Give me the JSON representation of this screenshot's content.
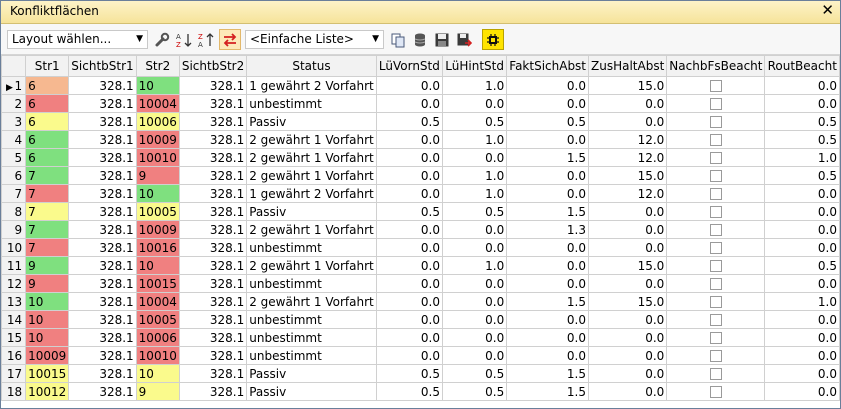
{
  "window": {
    "title": "Konfliktflächen"
  },
  "toolbar": {
    "layout_select": "Layout wählen...",
    "list_select": "<Einfache Liste>"
  },
  "colors": {
    "green": "#7fe07f",
    "red": "#f08080",
    "yellow": "#fafa8c",
    "orange": "#f6b890"
  },
  "columns": [
    "Str1",
    "SichtbStr1",
    "Str2",
    "SichtbStr2",
    "Status",
    "LüVornStd",
    "LüHintStd",
    "FaktSichAbst",
    "ZusHaltAbst",
    "NachbFsBeacht",
    "RoutBeacht"
  ],
  "rows": [
    {
      "n": "1",
      "str1": "6",
      "str1_color": "orange",
      "sichtb1": "328.1",
      "str2": "10",
      "str2_color": "green",
      "sichtb2": "328.1",
      "status": "1 gewährt 2 Vorfahrt",
      "luvorn": "0.0",
      "luhint": "1.0",
      "fakt": "0.0",
      "zus": "15.0",
      "rout": "0.0"
    },
    {
      "n": "2",
      "str1": "6",
      "str1_color": "red",
      "sichtb1": "328.1",
      "str2": "10004",
      "str2_color": "red",
      "sichtb2": "328.1",
      "status": "unbestimmt",
      "luvorn": "0.0",
      "luhint": "0.0",
      "fakt": "0.0",
      "zus": "0.0",
      "rout": "0.0"
    },
    {
      "n": "3",
      "str1": "6",
      "str1_color": "yellow",
      "sichtb1": "328.1",
      "str2": "10006",
      "str2_color": "yellow",
      "sichtb2": "328.1",
      "status": "Passiv",
      "luvorn": "0.5",
      "luhint": "0.5",
      "fakt": "0.5",
      "zus": "0.0",
      "rout": "0.5"
    },
    {
      "n": "4",
      "str1": "6",
      "str1_color": "green",
      "sichtb1": "328.1",
      "str2": "10009",
      "str2_color": "red",
      "sichtb2": "328.1",
      "status": "2 gewährt 1 Vorfahrt",
      "luvorn": "0.0",
      "luhint": "1.0",
      "fakt": "0.0",
      "zus": "12.0",
      "rout": "0.5"
    },
    {
      "n": "5",
      "str1": "6",
      "str1_color": "green",
      "sichtb1": "328.1",
      "str2": "10010",
      "str2_color": "red",
      "sichtb2": "328.1",
      "status": "2 gewährt 1 Vorfahrt",
      "luvorn": "0.0",
      "luhint": "0.0",
      "fakt": "1.5",
      "zus": "12.0",
      "rout": "1.0"
    },
    {
      "n": "6",
      "str1": "7",
      "str1_color": "green",
      "sichtb1": "328.1",
      "str2": "9",
      "str2_color": "red",
      "sichtb2": "328.1",
      "status": "2 gewährt 1 Vorfahrt",
      "luvorn": "0.0",
      "luhint": "1.0",
      "fakt": "0.0",
      "zus": "15.0",
      "rout": "0.5"
    },
    {
      "n": "7",
      "str1": "7",
      "str1_color": "red",
      "sichtb1": "328.1",
      "str2": "10",
      "str2_color": "green",
      "sichtb2": "328.1",
      "status": "1 gewährt 2 Vorfahrt",
      "luvorn": "0.0",
      "luhint": "1.0",
      "fakt": "0.0",
      "zus": "12.0",
      "rout": "0.0"
    },
    {
      "n": "8",
      "str1": "7",
      "str1_color": "yellow",
      "sichtb1": "328.1",
      "str2": "10005",
      "str2_color": "yellow",
      "sichtb2": "328.1",
      "status": "Passiv",
      "luvorn": "0.5",
      "luhint": "0.5",
      "fakt": "1.5",
      "zus": "0.0",
      "rout": "0.0"
    },
    {
      "n": "9",
      "str1": "7",
      "str1_color": "green",
      "sichtb1": "328.1",
      "str2": "10009",
      "str2_color": "red",
      "sichtb2": "328.1",
      "status": "2 gewährt 1 Vorfahrt",
      "luvorn": "0.0",
      "luhint": "0.0",
      "fakt": "1.3",
      "zus": "0.0",
      "rout": "0.0"
    },
    {
      "n": "10",
      "str1": "7",
      "str1_color": "red",
      "sichtb1": "328.1",
      "str2": "10016",
      "str2_color": "red",
      "sichtb2": "328.1",
      "status": "unbestimmt",
      "luvorn": "0.0",
      "luhint": "0.0",
      "fakt": "0.0",
      "zus": "0.0",
      "rout": "0.0"
    },
    {
      "n": "11",
      "str1": "9",
      "str1_color": "green",
      "sichtb1": "328.1",
      "str2": "10",
      "str2_color": "red",
      "sichtb2": "328.1",
      "status": "2 gewährt 1 Vorfahrt",
      "luvorn": "0.0",
      "luhint": "1.0",
      "fakt": "0.0",
      "zus": "15.0",
      "rout": "0.5"
    },
    {
      "n": "12",
      "str1": "9",
      "str1_color": "red",
      "sichtb1": "328.1",
      "str2": "10015",
      "str2_color": "red",
      "sichtb2": "328.1",
      "status": "unbestimmt",
      "luvorn": "0.0",
      "luhint": "0.0",
      "fakt": "0.0",
      "zus": "0.0",
      "rout": "0.0"
    },
    {
      "n": "13",
      "str1": "10",
      "str1_color": "green",
      "sichtb1": "328.1",
      "str2": "10004",
      "str2_color": "red",
      "sichtb2": "328.1",
      "status": "2 gewährt 1 Vorfahrt",
      "luvorn": "0.0",
      "luhint": "0.0",
      "fakt": "1.5",
      "zus": "15.0",
      "rout": "1.0"
    },
    {
      "n": "14",
      "str1": "10",
      "str1_color": "red",
      "sichtb1": "328.1",
      "str2": "10005",
      "str2_color": "red",
      "sichtb2": "328.1",
      "status": "unbestimmt",
      "luvorn": "0.0",
      "luhint": "0.0",
      "fakt": "0.0",
      "zus": "0.0",
      "rout": "0.0"
    },
    {
      "n": "15",
      "str1": "10",
      "str1_color": "red",
      "sichtb1": "328.1",
      "str2": "10006",
      "str2_color": "red",
      "sichtb2": "328.1",
      "status": "unbestimmt",
      "luvorn": "0.0",
      "luhint": "0.0",
      "fakt": "0.0",
      "zus": "0.0",
      "rout": "0.0"
    },
    {
      "n": "16",
      "str1": "10009",
      "str1_color": "red",
      "sichtb1": "328.1",
      "str2": "10010",
      "str2_color": "red",
      "sichtb2": "328.1",
      "status": "unbestimmt",
      "luvorn": "0.0",
      "luhint": "0.0",
      "fakt": "0.0",
      "zus": "0.0",
      "rout": "0.0"
    },
    {
      "n": "17",
      "str1": "10015",
      "str1_color": "yellow",
      "sichtb1": "328.1",
      "str2": "10",
      "str2_color": "yellow",
      "sichtb2": "328.1",
      "status": "Passiv",
      "luvorn": "0.5",
      "luhint": "0.5",
      "fakt": "1.5",
      "zus": "0.0",
      "rout": "0.0"
    },
    {
      "n": "18",
      "str1": "10012",
      "str1_color": "yellow",
      "sichtb1": "328.1",
      "str2": "9",
      "str2_color": "yellow",
      "sichtb2": "328.1",
      "status": "Passiv",
      "luvorn": "0.5",
      "luhint": "0.5",
      "fakt": "1.5",
      "zus": "0.0",
      "rout": "0.0"
    }
  ]
}
